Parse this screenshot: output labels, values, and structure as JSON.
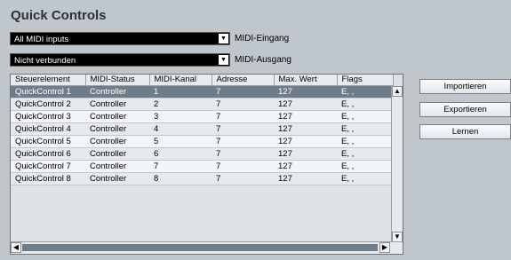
{
  "title": "Quick Controls",
  "input": {
    "value": "All MIDI inputs",
    "label": "MIDI-Eingang"
  },
  "output": {
    "value": "Nicht verbunden",
    "label": "MIDI-Ausgang"
  },
  "table": {
    "columns": [
      "Steuerelement",
      "MIDI-Status",
      "MIDI-Kanal",
      "Adresse",
      "Max. Wert",
      "Flags"
    ],
    "rows": [
      [
        "QuickControl 1",
        "Controller",
        "1",
        "7",
        "127",
        "E, ,"
      ],
      [
        "QuickControl 2",
        "Controller",
        "2",
        "7",
        "127",
        "E, ,"
      ],
      [
        "QuickControl 3",
        "Controller",
        "3",
        "7",
        "127",
        "E, ,"
      ],
      [
        "QuickControl 4",
        "Controller",
        "4",
        "7",
        "127",
        "E, ,"
      ],
      [
        "QuickControl 5",
        "Controller",
        "5",
        "7",
        "127",
        "E, ,"
      ],
      [
        "QuickControl 6",
        "Controller",
        "6",
        "7",
        "127",
        "E, ,"
      ],
      [
        "QuickControl 7",
        "Controller",
        "7",
        "7",
        "127",
        "E, ,"
      ],
      [
        "QuickControl 8",
        "Controller",
        "8",
        "7",
        "127",
        "E, ,"
      ]
    ],
    "selected_row": 0
  },
  "buttons": {
    "import": "Importieren",
    "export": "Exportieren",
    "learn": "Lernen"
  },
  "icons": {
    "dropdown": "chevron-down-icon",
    "scroll_up": "arrow-up-icon",
    "scroll_down": "arrow-down-icon",
    "scroll_left": "arrow-left-icon",
    "scroll_right": "arrow-right-icon"
  },
  "colors": {
    "background": "#bfc6cc",
    "selection": "#6f7c89",
    "dropdown_bg": "#000000"
  }
}
